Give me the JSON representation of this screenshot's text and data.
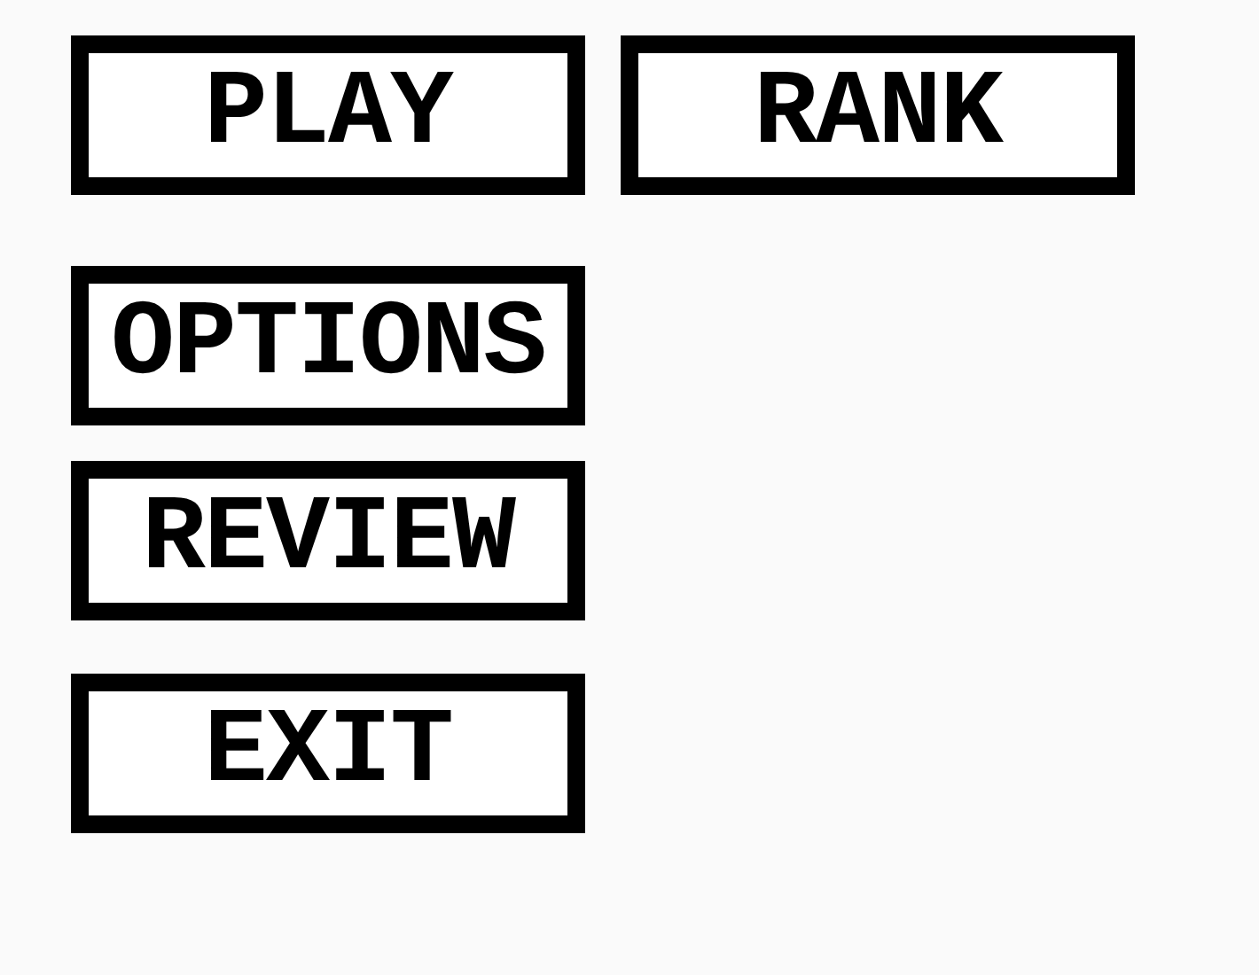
{
  "menu_rows": [
    {
      "buttons": [
        "PLAY",
        "RANK"
      ]
    },
    {
      "buttons": [
        "OPTIONS"
      ]
    },
    {
      "buttons": [
        "REVIEW"
      ]
    },
    {
      "buttons": [
        "EXIT"
      ]
    }
  ]
}
